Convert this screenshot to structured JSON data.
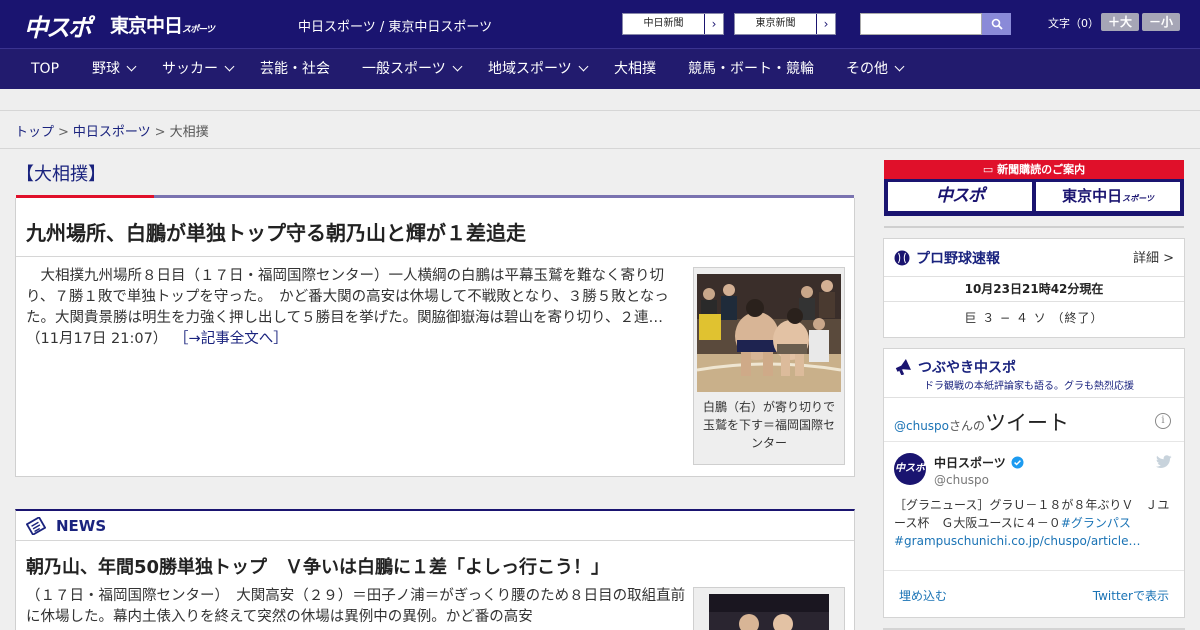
{
  "header": {
    "logo_chuspo": "中スポ",
    "logo_tokyo": "東京中日",
    "logo_tokyo_small": "スポーツ",
    "site_title": "中日スポーツ / 東京中日スポーツ",
    "paper_links": [
      {
        "label": "中日新聞",
        "arrow": "›"
      },
      {
        "label": "東京新聞",
        "arrow": "›"
      }
    ],
    "search": {
      "placeholder": "",
      "icon": "search-icon"
    },
    "font_size_label": "文字（0）",
    "font_larger": "＋大",
    "font_smaller": "－小"
  },
  "nav": {
    "items": [
      {
        "label": "TOP",
        "has_dropdown": false
      },
      {
        "label": "野球",
        "has_dropdown": true
      },
      {
        "label": "サッカー",
        "has_dropdown": true
      },
      {
        "label": "芸能・社会",
        "has_dropdown": false
      },
      {
        "label": "一般スポーツ",
        "has_dropdown": true
      },
      {
        "label": "地域スポーツ",
        "has_dropdown": true
      },
      {
        "label": "大相撲",
        "has_dropdown": false
      },
      {
        "label": "競馬・ボート・競輪",
        "has_dropdown": false
      },
      {
        "label": "その他",
        "has_dropdown": true
      }
    ]
  },
  "breadcrumb": {
    "items": [
      "トップ",
      "中日スポーツ",
      "大相撲"
    ],
    "separator": ">"
  },
  "section": {
    "title": "【大相撲】",
    "accent_color": "#e0102a"
  },
  "top_article": {
    "headline": "九州場所、白鵬が単独トップ守る朝乃山と輝が１差追走",
    "body": "　大相撲九州場所８日目（１７日・福岡国際センター）一人横綱の白鵬は平幕玉鷲を難なく寄り切り、７勝１敗で単独トップを守った。　かど番大関の高安は休場して不戦敗となり、３勝５敗となった。大関貴景勝は明生を力強く押し出して５勝目を挙げた。関脇御嶽海は碧山を寄り切り、２連…（11月17日 21:07）",
    "more_link": "［→記事全文へ］",
    "photo_caption": "白鵬（右）が寄り切りで玉鷲を下す＝福岡国際センター"
  },
  "news": {
    "label": "NEWS",
    "headline": "朝乃山、年間50勝単独トップ　Ｖ争いは白鵬に１差「よしっ行こう！」",
    "body": "（１７日・福岡国際センター）　大関高安（２９）＝田子ノ浦＝がぎっくり腰のため８日目の取組直前に休場した。幕内土俵入りを終えて突然の休場は異例中の異例。かど番の高安"
  },
  "sidebar": {
    "promo": {
      "title": "新聞購読のご案内",
      "button_a": "中スポ",
      "button_b": "東京中日",
      "button_b_small": "スポーツ"
    },
    "baseball": {
      "title": "プロ野球速報",
      "detail_link": "詳細 >",
      "timestamp": "10月23日21時42分現在",
      "score": "巨 ３ − ４ ソ （終了）"
    },
    "tweets": {
      "title": "つぶやき中スポ",
      "subtitle": "ドラ観戦の本紙評論家も語る。グラも熱烈応援",
      "by_handle": "@chuspo",
      "by_suffix": "さんの",
      "by_heading": "ツイート",
      "info": "i",
      "account_name": "中日スポーツ",
      "account_handle": "@chuspo",
      "avatar_text": "中スポ",
      "tweet_text": "［グラニュース］グラＵ－１８が８年ぶりＶ　Ｊユース杯　Ｇ大阪ユースに４－０",
      "tweet_hashtag": "#グランパス",
      "tweet_link": "#grampuschunichi.co.jp/chuspo/article…",
      "embed_link": "埋め込む",
      "view_link": "Twitterで表示"
    }
  },
  "colors": {
    "header_bg": "#1a1470",
    "nav_bg": "#221b6e",
    "accent_red": "#e0102a",
    "link_blue": "#1a73b5"
  }
}
